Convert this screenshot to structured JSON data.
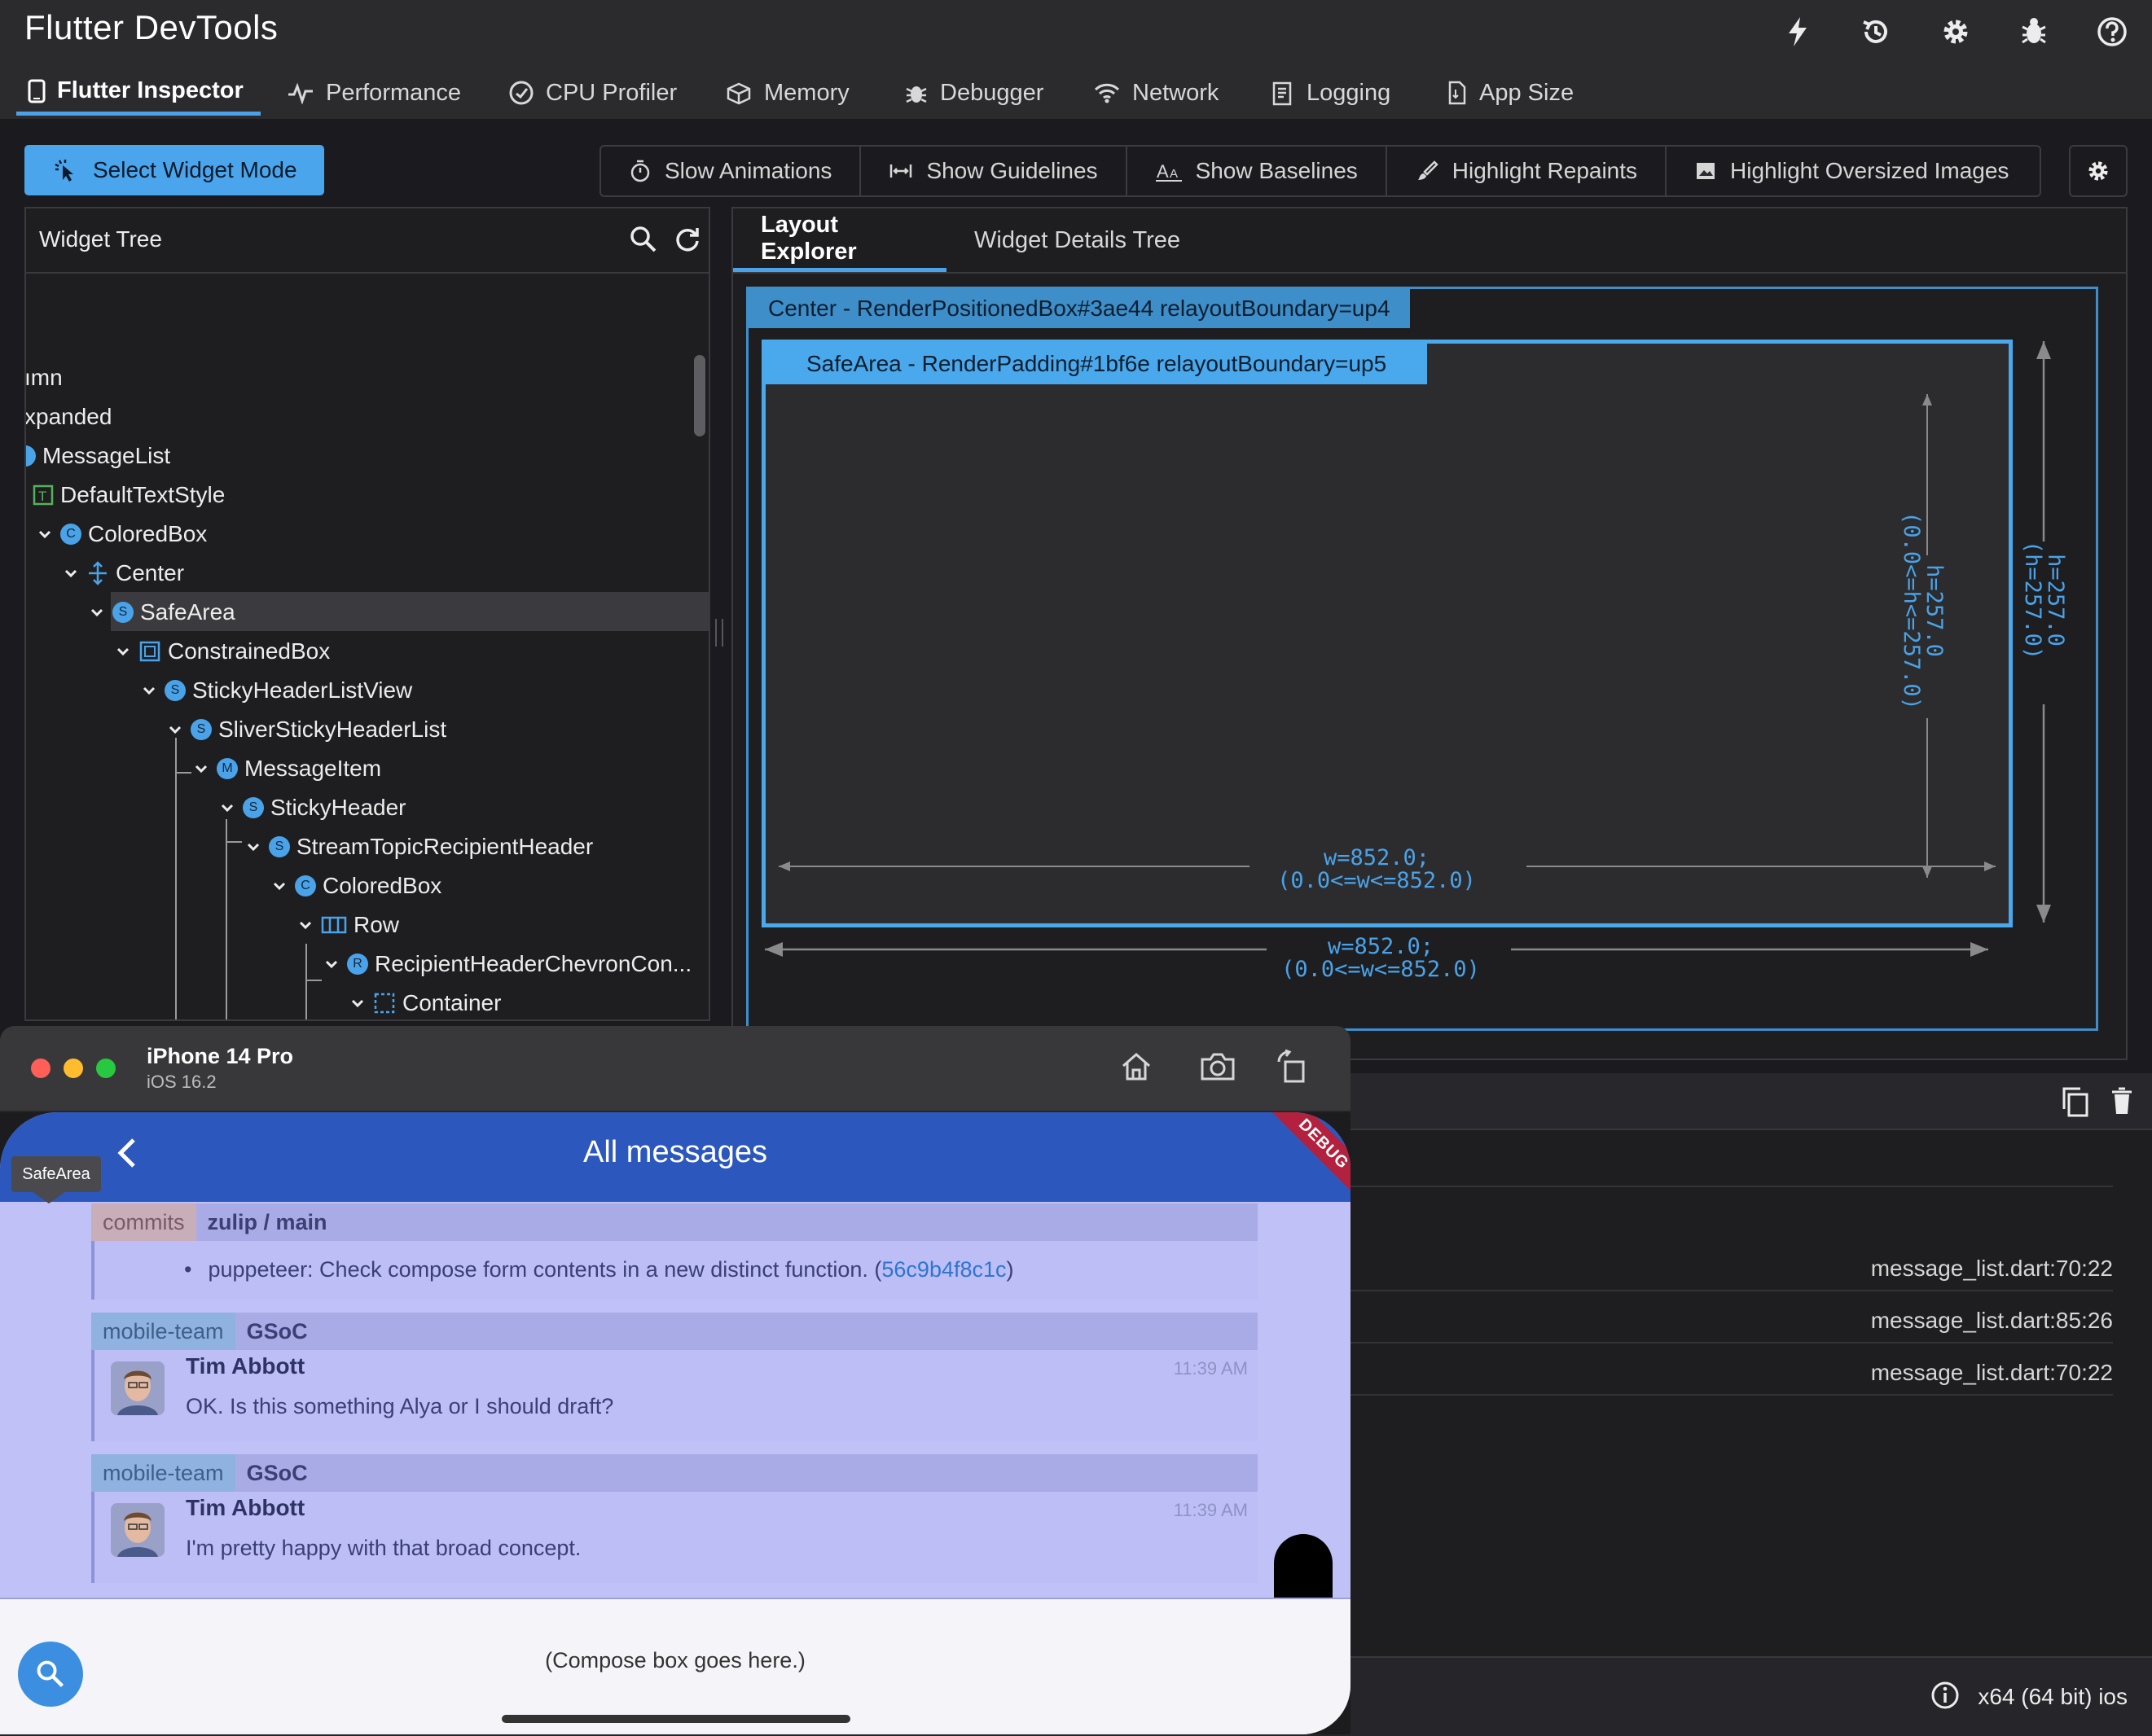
{
  "app": {
    "title": "Flutter DevTools"
  },
  "top_actions": [
    "bolt-icon",
    "history-icon",
    "gear-icon",
    "bug-icon",
    "help-icon"
  ],
  "tabs": [
    {
      "label": "Flutter Inspector",
      "icon": "phone-icon",
      "active": true
    },
    {
      "label": "Performance",
      "icon": "pulse-icon"
    },
    {
      "label": "CPU Profiler",
      "icon": "gauge-icon"
    },
    {
      "label": "Memory",
      "icon": "memory-icon"
    },
    {
      "label": "Debugger",
      "icon": "bug-icon"
    },
    {
      "label": "Network",
      "icon": "wifi-icon"
    },
    {
      "label": "Logging",
      "icon": "logging-icon"
    },
    {
      "label": "App Size",
      "icon": "file-icon"
    }
  ],
  "toolbar": {
    "select_widget_mode": "Select Widget Mode",
    "overlays": [
      "Slow Animations",
      "Show Guidelines",
      "Show Baselines",
      "Highlight Repaints",
      "Highlight Oversized Images"
    ]
  },
  "widget_tree": {
    "title": "Widget Tree",
    "rows": [
      {
        "label": "ımn"
      },
      {
        "label": "xpanded"
      },
      {
        "label": "MessageList"
      },
      {
        "label": "DefaultTextStyle",
        "badge": "T"
      },
      {
        "label": "ColoredBox",
        "badge": "C"
      },
      {
        "label": "Center"
      },
      {
        "label": "SafeArea",
        "badge": "S"
      },
      {
        "label": "ConstrainedBox"
      },
      {
        "label": "StickyHeaderListView",
        "badge": "S"
      },
      {
        "label": "SliverStickyHeaderList",
        "badge": "S"
      },
      {
        "label": "MessageItem",
        "badge": "M"
      },
      {
        "label": "StickyHeader",
        "badge": "S"
      },
      {
        "label": "StreamTopicRecipientHeader",
        "badge": "S"
      },
      {
        "label": "ColoredBox",
        "badge": "C"
      },
      {
        "label": "Row"
      },
      {
        "label": "RecipientHeaderChevronCon...",
        "badge": "R"
      },
      {
        "label": "Container"
      }
    ]
  },
  "layout_explorer": {
    "tabs": [
      "Layout Explorer",
      "Widget Details Tree"
    ],
    "outer_label": "Center - RenderPositionedBox#3ae44 relayoutBoundary=up4",
    "inner_label": "SafeArea - RenderPadding#1bf6e relayoutBoundary=up5",
    "inner_width_line1": "w=852.0;",
    "inner_width_line2": "(0.0<=w<=852.0)",
    "inner_height_line1": "h=257.0",
    "inner_height_line2": "(0.0<=h<=257.0)",
    "outer_width_line1": "w=852.0;",
    "outer_width_line2": "(0.0<=w<=852.0)",
    "outer_height_line1": "h=257.0",
    "outer_height_line2": "(h=257.0)"
  },
  "locations": [
    "message_list.dart:70:22",
    "message_list.dart:85:26",
    "message_list.dart:70:22"
  ],
  "status": {
    "platform": "x64 (64 bit) ios"
  },
  "simulator": {
    "device": "iPhone 14 Pro",
    "os": "iOS 16.2",
    "appbar_title": "All messages",
    "debug_banner": "DEBUG",
    "tooltip": "SafeArea",
    "messages": [
      {
        "stream": "commits",
        "topic": "zulip / main",
        "bullet": "puppeteer: Check compose form contents in a new distinct function. (",
        "link": "56c9b4f8c1c",
        "bullet_end": ")"
      },
      {
        "stream": "mobile-team",
        "topic": "GSoC",
        "sender": "Tim Abbott",
        "time": "11:39 AM",
        "content": "OK. Is this something Alya or I should draft?"
      },
      {
        "stream": "mobile-team",
        "topic": "GSoC",
        "sender": "Tim Abbott",
        "time": "11:39 AM",
        "content": "I'm pretty happy with that broad concept."
      }
    ],
    "compose_placeholder": "(Compose box goes here.)"
  }
}
